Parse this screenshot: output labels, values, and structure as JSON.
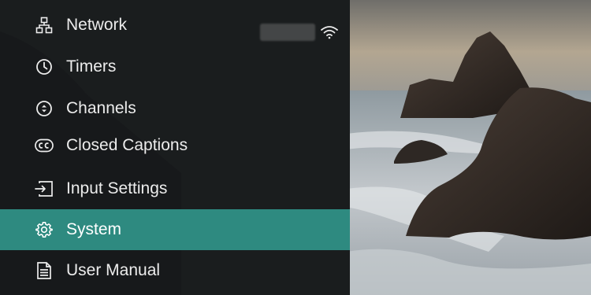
{
  "menu": {
    "items": [
      {
        "label": "Network",
        "icon": "network-icon"
      },
      {
        "label": "Timers",
        "icon": "clock-icon"
      },
      {
        "label": "Channels",
        "icon": "channels-icon"
      },
      {
        "label": "Closed Captions",
        "icon": "cc-icon"
      },
      {
        "label": "Input Settings",
        "icon": "input-icon"
      },
      {
        "label": "System",
        "icon": "gear-icon",
        "selected": true
      },
      {
        "label": "User Manual",
        "icon": "document-icon"
      }
    ],
    "network_status_icon": "wifi-icon"
  },
  "colors": {
    "selected_highlight": "#2e8a80",
    "panel_overlay": "#16181a",
    "text": "#ececec"
  }
}
